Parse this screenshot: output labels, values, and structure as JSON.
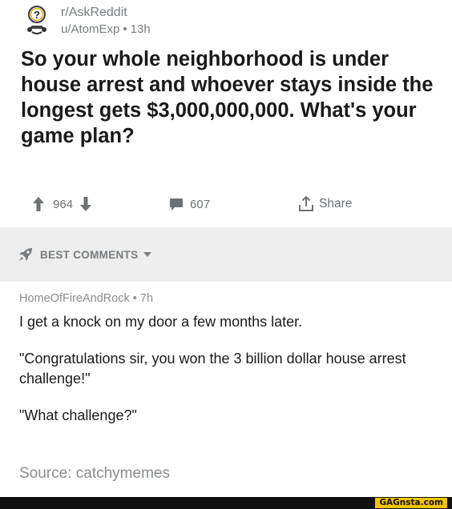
{
  "post": {
    "subreddit": "r/AskReddit",
    "author": "u/AtomExp",
    "separator": "•",
    "age": "13h",
    "title": "So your whole neighborhood is under house arrest and whoever stays inside the longest gets $3,000,000,000. What's your game plan?",
    "votes": "964",
    "comments": "607",
    "share_label": "Share"
  },
  "comments_section": {
    "sort_label": "BEST COMMENTS"
  },
  "comment": {
    "author": "HomeOfFireAndRock",
    "separator": "•",
    "age": "7h",
    "paragraphs": [
      "I get a knock on my door a few months later.",
      "\"Congratulations sir, you won the 3 billion dollar house arrest challenge!\"",
      "\"What challenge?\""
    ]
  },
  "source": "Source: catchymemes",
  "watermark": "GAGnsta.com",
  "colors": {
    "text": "#1a1a1b",
    "muted": "#787c7e",
    "band": "#eeeeee",
    "watermark_bg": "#f2c500"
  },
  "icons": {
    "subreddit": "askreddit-snoo-icon",
    "upvote": "upvote-arrow-icon",
    "downvote": "downvote-arrow-icon",
    "comments": "comment-bubble-icon",
    "share": "share-icon",
    "sort": "rocket-icon",
    "sort_caret": "caret-down-icon"
  }
}
